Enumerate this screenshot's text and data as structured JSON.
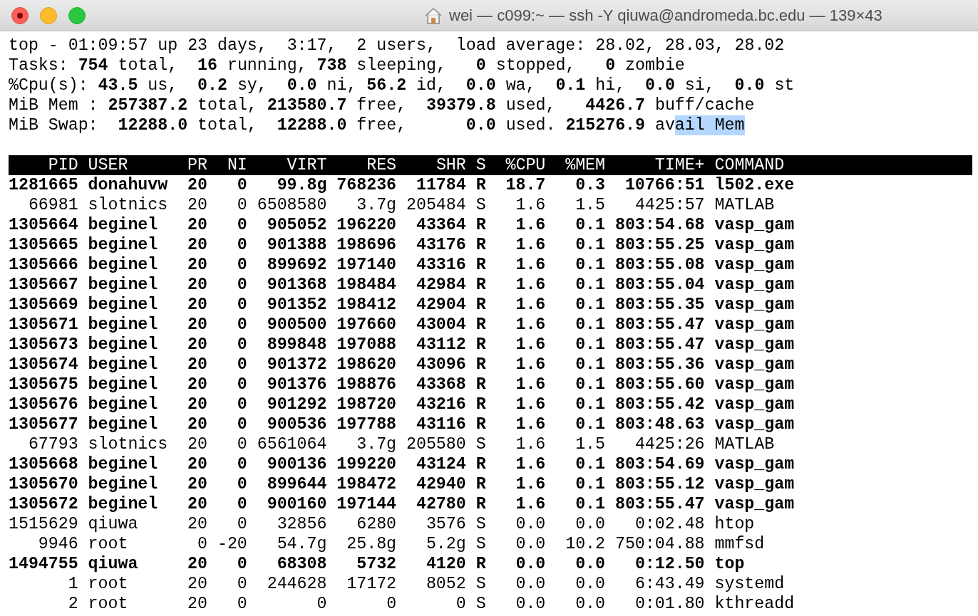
{
  "window": {
    "title": "wei — c099:~ — ssh -Y qiuwa@andromeda.bc.edu — 139×43"
  },
  "summary": [
    {
      "text": "top - 01:09:57 up 23 days,  3:17,  2 users,  load average: 28.02, 28.03, 28.02"
    },
    {
      "text": "Tasks: **754** total,  **16** running, **738** sleeping,   **0** stopped,   **0** zombie"
    },
    {
      "text": "%Cpu(s): **43.5** us,  **0.2** sy,  **0.0** ni, **56.2** id,  **0.0** wa,  **0.1** hi,  **0.0** si,  **0.0** st"
    },
    {
      "text": "MiB Mem : **257387.2** total, **213580.7** free,  **39379.8** used,   **4426.7** buff/cache"
    },
    {
      "text": "MiB Swap:  **12288.0** total,  **12288.0** free,      **0.0** used. **215276.9** av",
      "selection": "ail Mem"
    }
  ],
  "table": {
    "columns": [
      "PID",
      "USER",
      "PR",
      "NI",
      "VIRT",
      "RES",
      "SHR",
      "S",
      "%CPU",
      "%MEM",
      "TIME+",
      "COMMAND"
    ],
    "rows": [
      {
        "bold": true,
        "cells": [
          "1281665",
          "donahuvw",
          "20",
          "0",
          "99.8g",
          "768236",
          "11784",
          "R",
          "18.7",
          "0.3",
          "10766:51",
          "l502.exe"
        ]
      },
      {
        "bold": false,
        "cells": [
          "66981",
          "slotnics",
          "20",
          "0",
          "6508580",
          "3.7g",
          "205484",
          "S",
          "1.6",
          "1.5",
          "4425:57",
          "MATLAB"
        ]
      },
      {
        "bold": true,
        "cells": [
          "1305664",
          "beginel",
          "20",
          "0",
          "905052",
          "196220",
          "43364",
          "R",
          "1.6",
          "0.1",
          "803:54.68",
          "vasp_gam"
        ]
      },
      {
        "bold": true,
        "cells": [
          "1305665",
          "beginel",
          "20",
          "0",
          "901388",
          "198696",
          "43176",
          "R",
          "1.6",
          "0.1",
          "803:55.25",
          "vasp_gam"
        ]
      },
      {
        "bold": true,
        "cells": [
          "1305666",
          "beginel",
          "20",
          "0",
          "899692",
          "197140",
          "43316",
          "R",
          "1.6",
          "0.1",
          "803:55.08",
          "vasp_gam"
        ]
      },
      {
        "bold": true,
        "cells": [
          "1305667",
          "beginel",
          "20",
          "0",
          "901368",
          "198484",
          "42984",
          "R",
          "1.6",
          "0.1",
          "803:55.04",
          "vasp_gam"
        ]
      },
      {
        "bold": true,
        "cells": [
          "1305669",
          "beginel",
          "20",
          "0",
          "901352",
          "198412",
          "42904",
          "R",
          "1.6",
          "0.1",
          "803:55.35",
          "vasp_gam"
        ]
      },
      {
        "bold": true,
        "cells": [
          "1305671",
          "beginel",
          "20",
          "0",
          "900500",
          "197660",
          "43004",
          "R",
          "1.6",
          "0.1",
          "803:55.47",
          "vasp_gam"
        ]
      },
      {
        "bold": true,
        "cells": [
          "1305673",
          "beginel",
          "20",
          "0",
          "899848",
          "197088",
          "43112",
          "R",
          "1.6",
          "0.1",
          "803:55.47",
          "vasp_gam"
        ]
      },
      {
        "bold": true,
        "cells": [
          "1305674",
          "beginel",
          "20",
          "0",
          "901372",
          "198620",
          "43096",
          "R",
          "1.6",
          "0.1",
          "803:55.36",
          "vasp_gam"
        ]
      },
      {
        "bold": true,
        "cells": [
          "1305675",
          "beginel",
          "20",
          "0",
          "901376",
          "198876",
          "43368",
          "R",
          "1.6",
          "0.1",
          "803:55.60",
          "vasp_gam"
        ]
      },
      {
        "bold": true,
        "cells": [
          "1305676",
          "beginel",
          "20",
          "0",
          "901292",
          "198720",
          "43216",
          "R",
          "1.6",
          "0.1",
          "803:55.42",
          "vasp_gam"
        ]
      },
      {
        "bold": true,
        "cells": [
          "1305677",
          "beginel",
          "20",
          "0",
          "900536",
          "197788",
          "43116",
          "R",
          "1.6",
          "0.1",
          "803:48.63",
          "vasp_gam"
        ]
      },
      {
        "bold": false,
        "cells": [
          "67793",
          "slotnics",
          "20",
          "0",
          "6561064",
          "3.7g",
          "205580",
          "S",
          "1.6",
          "1.5",
          "4425:26",
          "MATLAB"
        ]
      },
      {
        "bold": true,
        "cells": [
          "1305668",
          "beginel",
          "20",
          "0",
          "900136",
          "199220",
          "43124",
          "R",
          "1.6",
          "0.1",
          "803:54.69",
          "vasp_gam"
        ]
      },
      {
        "bold": true,
        "cells": [
          "1305670",
          "beginel",
          "20",
          "0",
          "899644",
          "198472",
          "42940",
          "R",
          "1.6",
          "0.1",
          "803:55.12",
          "vasp_gam"
        ]
      },
      {
        "bold": true,
        "cells": [
          "1305672",
          "beginel",
          "20",
          "0",
          "900160",
          "197144",
          "42780",
          "R",
          "1.6",
          "0.1",
          "803:55.47",
          "vasp_gam"
        ]
      },
      {
        "bold": false,
        "cells": [
          "1515629",
          "qiuwa",
          "20",
          "0",
          "32856",
          "6280",
          "3576",
          "S",
          "0.0",
          "0.0",
          "0:02.48",
          "htop"
        ]
      },
      {
        "bold": false,
        "cells": [
          "9946",
          "root",
          "0",
          "-20",
          "54.7g",
          "25.8g",
          "5.2g",
          "S",
          "0.0",
          "10.2",
          "750:04.88",
          "mmfsd"
        ]
      },
      {
        "bold": true,
        "cells": [
          "1494755",
          "qiuwa",
          "20",
          "0",
          "68308",
          "5732",
          "4120",
          "R",
          "0.0",
          "0.0",
          "0:12.50",
          "top"
        ]
      },
      {
        "bold": false,
        "cells": [
          "1",
          "root",
          "20",
          "0",
          "244628",
          "17172",
          "8052",
          "S",
          "0.0",
          "0.0",
          "6:43.49",
          "systemd"
        ]
      },
      {
        "bold": false,
        "cells": [
          "2",
          "root",
          "20",
          "0",
          "0",
          "0",
          "0",
          "S",
          "0.0",
          "0.0",
          "0:01.80",
          "kthreadd"
        ]
      }
    ]
  }
}
